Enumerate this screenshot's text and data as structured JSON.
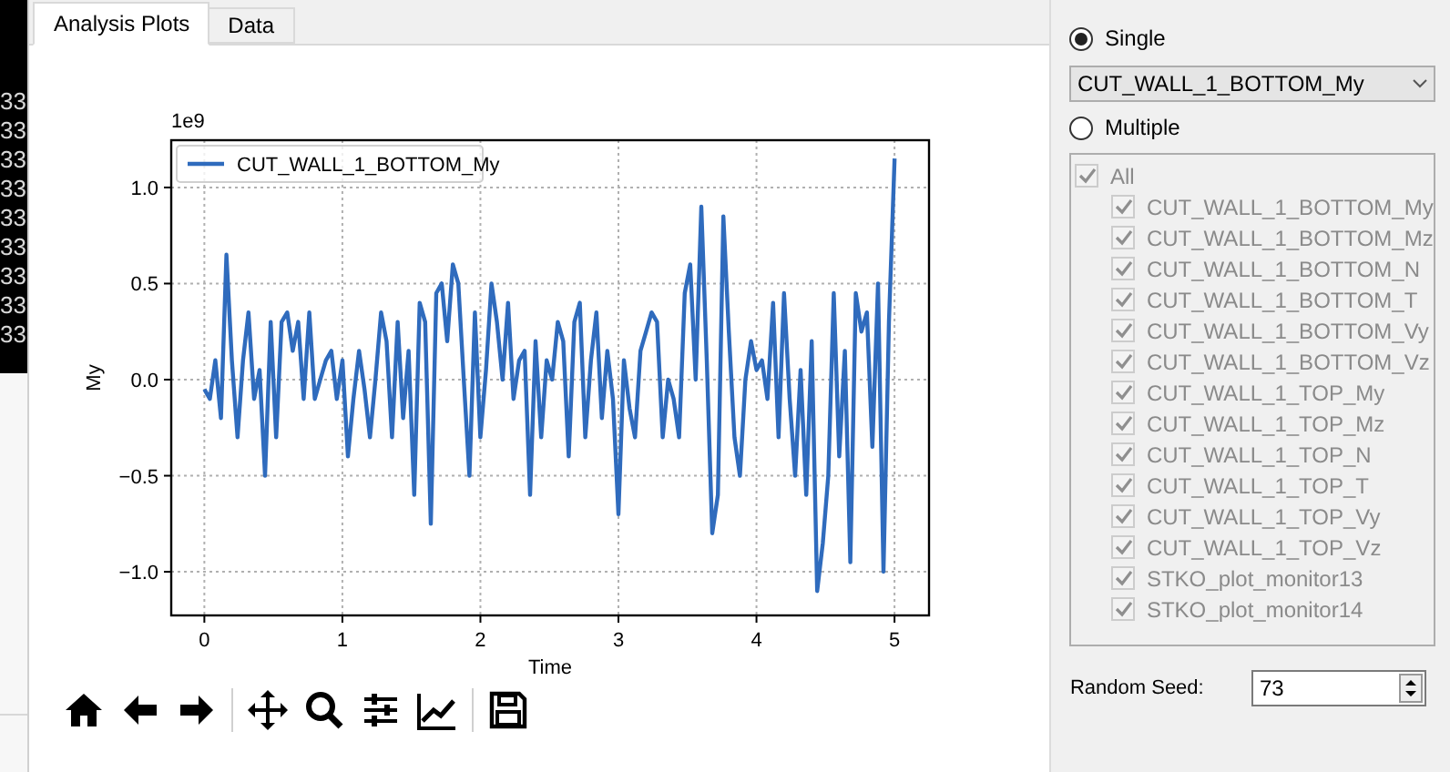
{
  "terminal_lines": [
    "33",
    "33",
    "33",
    "33",
    "33",
    "33",
    "33",
    "33",
    "33"
  ],
  "tabs": [
    {
      "label": "Analysis Plots",
      "selected": true
    },
    {
      "label": "Data",
      "selected": false
    }
  ],
  "plot": {
    "offset_label": "1e9",
    "chart_data": {
      "type": "line",
      "grid": true,
      "xlabel": "Time",
      "ylabel": "My",
      "xlim": [
        -0.24,
        5.25
      ],
      "ylim": [
        -1.227,
        1.246
      ],
      "xticks": [
        0,
        1,
        2,
        3,
        4,
        5
      ],
      "yticks": [
        {
          "value": -1,
          "label": "−1.0"
        },
        {
          "value": -0.5,
          "label": "−0.5"
        },
        {
          "value": 0,
          "label": "0.0"
        },
        {
          "value": 0.5,
          "label": "0.5"
        },
        {
          "value": 1,
          "label": "1.0"
        }
      ],
      "x": [
        0,
        0.04,
        0.08,
        0.12,
        0.16,
        0.2,
        0.24,
        0.28,
        0.32,
        0.36,
        0.4,
        0.44,
        0.48,
        0.52,
        0.56,
        0.6,
        0.64,
        0.68,
        0.72,
        0.76,
        0.8,
        0.84,
        0.88,
        0.92,
        0.96,
        1,
        1.04,
        1.08,
        1.12,
        1.16,
        1.2,
        1.24,
        1.28,
        1.32,
        1.36,
        1.4,
        1.44,
        1.48,
        1.52,
        1.56,
        1.6,
        1.64,
        1.68,
        1.72,
        1.76,
        1.8,
        1.84,
        1.88,
        1.92,
        1.96,
        2,
        2.04,
        2.08,
        2.12,
        2.16,
        2.2,
        2.24,
        2.28,
        2.32,
        2.36,
        2.4,
        2.44,
        2.48,
        2.52,
        2.56,
        2.6,
        2.64,
        2.68,
        2.72,
        2.76,
        2.8,
        2.84,
        2.88,
        2.92,
        2.96,
        3,
        3.04,
        3.08,
        3.12,
        3.16,
        3.2,
        3.24,
        3.28,
        3.32,
        3.36,
        3.4,
        3.44,
        3.48,
        3.52,
        3.56,
        3.6,
        3.64,
        3.68,
        3.72,
        3.76,
        3.8,
        3.84,
        3.88,
        3.92,
        3.96,
        4,
        4.04,
        4.08,
        4.12,
        4.16,
        4.2,
        4.24,
        4.28,
        4.32,
        4.36,
        4.4,
        4.44,
        4.48,
        4.52,
        4.56,
        4.6,
        4.64,
        4.68,
        4.72,
        4.76,
        4.8,
        4.84,
        4.88,
        4.92,
        4.96,
        5
      ],
      "series": [
        {
          "name": "CUT_WALL_1_BOTTOM_My",
          "color": "#2f6bbd",
          "values": [
            -0.05,
            -0.1,
            0.1,
            -0.2,
            0.65,
            0.1,
            -0.3,
            0.1,
            0.35,
            -0.1,
            0.05,
            -0.5,
            0.3,
            -0.3,
            0.3,
            0.35,
            0.15,
            0.3,
            -0.1,
            0.35,
            -0.1,
            0.0,
            0.1,
            0.15,
            -0.1,
            0.1,
            -0.4,
            -0.1,
            0.15,
            -0.05,
            -0.3,
            0.0,
            0.35,
            0.2,
            -0.3,
            0.3,
            -0.2,
            0.15,
            -0.6,
            0.4,
            0.3,
            -0.75,
            0.45,
            0.5,
            0.2,
            0.6,
            0.5,
            0.0,
            -0.5,
            0.35,
            -0.3,
            0.05,
            0.5,
            0.3,
            0.0,
            0.4,
            -0.1,
            0.1,
            0.15,
            -0.6,
            0.2,
            -0.3,
            0.1,
            0.0,
            0.3,
            0.2,
            -0.4,
            0.3,
            0.4,
            -0.3,
            0.1,
            0.35,
            -0.2,
            0.15,
            -0.1,
            -0.7,
            0.1,
            -0.15,
            -0.3,
            0.15,
            0.25,
            0.35,
            0.3,
            -0.3,
            0.0,
            -0.1,
            -0.3,
            0.45,
            0.6,
            0.0,
            0.9,
            0.1,
            -0.8,
            -0.6,
            0.85,
            0.25,
            -0.3,
            -0.5,
            0.0,
            0.2,
            0.05,
            0.1,
            -0.1,
            0.4,
            -0.3,
            0.45,
            -0.1,
            -0.5,
            0.05,
            -0.6,
            0.2,
            -1.1,
            -0.85,
            -0.5,
            0.45,
            -0.4,
            0.15,
            -0.95,
            0.45,
            0.25,
            0.35,
            -0.35,
            0.5,
            -1.0,
            0.3,
            1.15
          ]
        }
      ]
    }
  },
  "mode": [
    {
      "label": "Single",
      "selected": true
    },
    {
      "label": "Multiple",
      "selected": false
    }
  ],
  "single_select": {
    "value": "CUT_WALL_1_BOTTOM_My"
  },
  "multiple_list": {
    "disabled": true,
    "items": [
      {
        "label": "All",
        "checked": true,
        "children": [
          {
            "label": "CUT_WALL_1_BOTTOM_My",
            "checked": true
          },
          {
            "label": "CUT_WALL_1_BOTTOM_Mz",
            "checked": true
          },
          {
            "label": "CUT_WALL_1_BOTTOM_N",
            "checked": true
          },
          {
            "label": "CUT_WALL_1_BOTTOM_T",
            "checked": true
          },
          {
            "label": "CUT_WALL_1_BOTTOM_Vy",
            "checked": true
          },
          {
            "label": "CUT_WALL_1_BOTTOM_Vz",
            "checked": true
          },
          {
            "label": "CUT_WALL_1_TOP_My",
            "checked": true
          },
          {
            "label": "CUT_WALL_1_TOP_Mz",
            "checked": true
          },
          {
            "label": "CUT_WALL_1_TOP_N",
            "checked": true
          },
          {
            "label": "CUT_WALL_1_TOP_T",
            "checked": true
          },
          {
            "label": "CUT_WALL_1_TOP_Vy",
            "checked": true
          },
          {
            "label": "CUT_WALL_1_TOP_Vz",
            "checked": true
          },
          {
            "label": "STKO_plot_monitor13",
            "checked": true
          },
          {
            "label": "STKO_plot_monitor14",
            "checked": true
          }
        ]
      }
    ]
  },
  "random_seed": {
    "label": "Random Seed:",
    "value": "73"
  }
}
